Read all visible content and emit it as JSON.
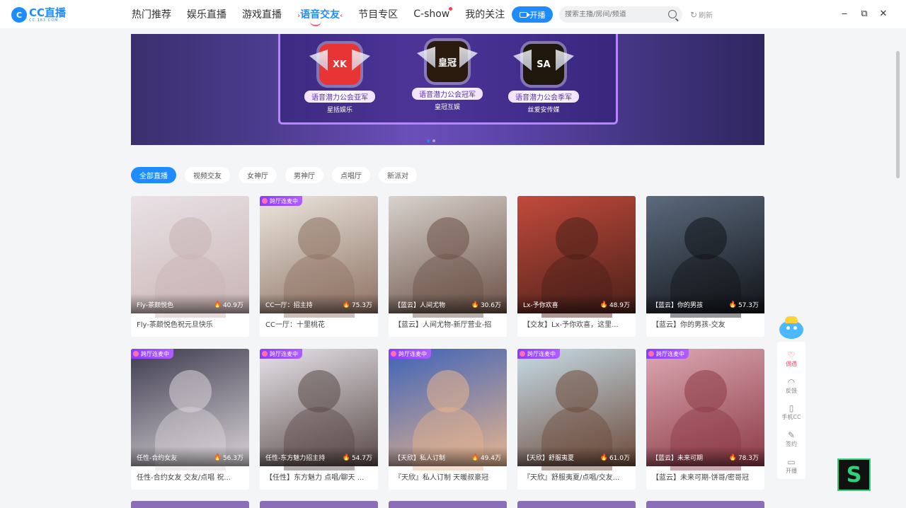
{
  "logo": {
    "mark": "C",
    "name": "CC直播",
    "sub": "CC.163.COM"
  },
  "nav": {
    "items": [
      {
        "label": "热门推荐"
      },
      {
        "label": "娱乐直播"
      },
      {
        "label": "游戏直播"
      },
      {
        "label": "语音交友",
        "active": true
      },
      {
        "label": "节目专区"
      },
      {
        "label": "C-show",
        "dot": true
      },
      {
        "label": "我的关注"
      }
    ],
    "live_button": "开播",
    "search_placeholder": "搜索主播/房间/频道",
    "refresh": "刷新"
  },
  "window_controls": {
    "minimize": "‒",
    "restore": "⧉",
    "close": "✕"
  },
  "banner": {
    "badges": [
      {
        "emblem": "XK",
        "title": "语音潜力公会亚军",
        "name": "星括娱乐",
        "color": "#e83434"
      },
      {
        "emblem": "皇冠",
        "title": "语音潜力公会冠军",
        "name": "皇冠互娱",
        "color": "#2a1b0e"
      },
      {
        "emblem": "SA",
        "title": "语音潜力公会季军",
        "name": "丝爱安传媒",
        "color": "#1f160c"
      }
    ]
  },
  "filters": [
    {
      "label": "全部直播",
      "active": true
    },
    {
      "label": "视频交友"
    },
    {
      "label": "女神厅"
    },
    {
      "label": "男神厅"
    },
    {
      "label": "点唱厅"
    },
    {
      "label": "新派对"
    }
  ],
  "cards": [
    {
      "tag": "",
      "name": "Fly-茶颜悦色",
      "pop": "40.9万",
      "title": "Fly-茶颜悦色祝元旦快乐",
      "bg": "#e9e2e6",
      "tone": "#c9b4b4"
    },
    {
      "tag": "跨厅连麦中",
      "name": "CC一厅：招主持",
      "pop": "75.3万",
      "title": "CC一厅：十里桃花",
      "bg": "#ece6de",
      "tone": "#8d7263"
    },
    {
      "tag": "",
      "name": "【蓝云】人间尤物",
      "pop": "30.6万",
      "title": "【蓝云】人间尤物-新厅营业-招",
      "bg": "#d8d2cd",
      "tone": "#6b5146"
    },
    {
      "tag": "",
      "name": "Lx-予你欢喜",
      "pop": "48.9万",
      "title": "【交友】Lx-予你欢喜，这里...",
      "bg": "#c24a3c",
      "tone": "#4a2018"
    },
    {
      "tag": "",
      "name": "【蓝云】你的男孩",
      "pop": "57.3万",
      "title": "【蓝云】你的男孩-交友",
      "bg": "#5c6a7e",
      "tone": "#111418"
    },
    {
      "tag": "跨厅连麦中",
      "name": "任性-合约女友",
      "pop": "56.3万",
      "title": "任性-合约女友 交友/点唱 祝...",
      "bg": "#3e3b4e",
      "tone": "#d9d4d8"
    },
    {
      "tag": "跨厅连麦中",
      "name": "任性-东方魅力招主持",
      "pop": "54.7万",
      "title": "【任性】东方魅力 点唱/聊天 ...",
      "bg": "#e7e4ea",
      "tone": "#5a4a48"
    },
    {
      "tag": "跨厅连麦中",
      "name": "【天欣】私人订制",
      "pop": "49.4万",
      "title": "『天欣』私人订制 天暖叔豪冠",
      "bg": "#3d63b8",
      "tone": "#e7b48e"
    },
    {
      "tag": "跨厅连麦中",
      "name": "【天欣】舒服夷夏",
      "pop": "61.0万",
      "title": "『天欣』舒服夷夏/点唱/交友...",
      "bg": "#c6dde8",
      "tone": "#6d4a3a"
    },
    {
      "tag": "跨厅连麦中",
      "name": "【蓝云】未来可期",
      "pop": "78.3万",
      "title": "【蓝云】未来可期-饼哥/密哥冠",
      "bg": "#dba9b3",
      "tone": "#8c3a46"
    }
  ],
  "float_bar": [
    {
      "icon": "♡",
      "label": "偶遇",
      "kind": "heart-icon"
    },
    {
      "icon": "◠",
      "label": "反馈",
      "kind": "headset-icon"
    },
    {
      "icon": "▯",
      "label": "手机CC",
      "kind": "phone-icon"
    },
    {
      "icon": "✎",
      "label": "签约",
      "kind": "edit-icon"
    },
    {
      "icon": "▭",
      "label": "开播",
      "kind": "camera-icon"
    }
  ],
  "corner_logo": "S"
}
